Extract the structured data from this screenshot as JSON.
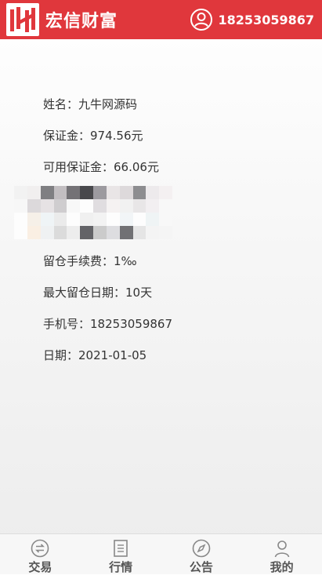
{
  "header": {
    "brand_name": "宏信财富",
    "phone": "18253059867"
  },
  "profile": {
    "rows": [
      {
        "label": "姓名：",
        "value": "九牛网源码"
      },
      {
        "label": "保证金：",
        "value": "974.56元"
      },
      {
        "label": "可用保证金：",
        "value": "66.06元"
      },
      {
        "label": "留仓手续费：",
        "value": "1‰"
      },
      {
        "label": "最大留仓日期：",
        "value": "10天"
      },
      {
        "label": "手机号：",
        "value": "18253059867"
      },
      {
        "label": "日期：",
        "value": "2021-01-05"
      }
    ]
  },
  "tabbar": {
    "items": [
      {
        "label": "交易",
        "icon": "swap-icon"
      },
      {
        "label": "行情",
        "icon": "document-icon"
      },
      {
        "label": "公告",
        "icon": "compass-icon"
      },
      {
        "label": "我的",
        "icon": "person-icon"
      }
    ]
  },
  "colors": {
    "header_bg": "#e0373c",
    "tab_icon": "#888888",
    "text": "#333333"
  }
}
